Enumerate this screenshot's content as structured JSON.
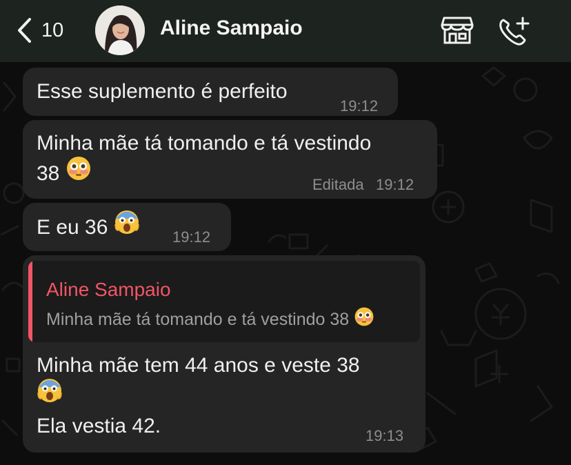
{
  "header": {
    "back_count": "10",
    "contact_name": "Aline Sampaio",
    "icons": [
      "chevron-left-icon",
      "avatar",
      "store-icon",
      "add-call-icon"
    ]
  },
  "messages": [
    {
      "text": "Esse suplemento é perfeito",
      "time": "19:12"
    },
    {
      "line1": "Minha mãe tá tomando e tá vestindo",
      "line2": "38",
      "emoji": "flushed-face",
      "edited_label": "Editada",
      "time": "19:12"
    },
    {
      "text": "E eu 36",
      "emoji": "screaming-face",
      "time": "19:12"
    },
    {
      "quote": {
        "author": "Aline Sampaio",
        "text": "Minha mãe tá tomando e tá vestindo 38",
        "emoji": "flushed-face"
      },
      "line1": "Minha mãe tem 44 anos e veste 38",
      "emoji": "screaming-face",
      "line3": "Ela vestia 42.",
      "time": "19:13"
    }
  ],
  "colors": {
    "header_bg": "#1d2420",
    "bubble_bg": "#252525",
    "quote_accent": "#f25565",
    "time_text": "#8e8e8e"
  }
}
